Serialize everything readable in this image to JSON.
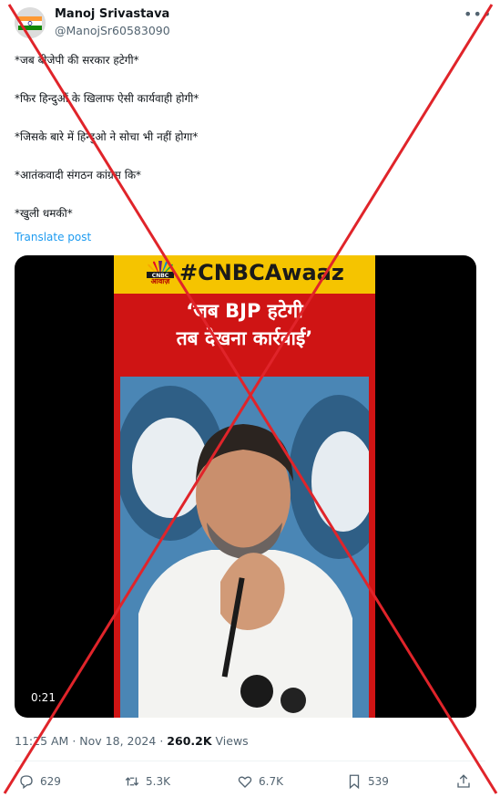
{
  "author": {
    "name": "Manoj Srivastava",
    "handle": "@ManojSr60583090"
  },
  "tweet_lines": [
    "*जब बीजेपी की सरकार हटेगी*",
    "*फिर हिन्दुओं के खिलाफ ऐसी कार्यवाही होगी*",
    "*जिसके बारे में हिन्दुओ ने सोचा भी नहीं होगा*",
    "*आतंकवादी संगठन कांग्रेस कि*",
    "*खुली धमकी*"
  ],
  "translate_label": "Translate post",
  "media": {
    "logo_text": "आवाज़",
    "hashtag": "#CNBCAwaaz",
    "quote_line1": "‘जब BJP हटेगी",
    "quote_line2": "तब देखना कार्रवाई’",
    "duration": "0:21"
  },
  "meta": {
    "time": "11:25 AM",
    "separator": "·",
    "date": "Nov 18, 2024",
    "views_count": "260.2K",
    "views_label": "Views"
  },
  "actions": {
    "replies": "629",
    "reposts": "5.3K",
    "likes": "6.7K",
    "bookmarks": "539"
  },
  "icons": {
    "more": "more-horizontal-icon",
    "reply": "reply-icon",
    "repost": "repost-icon",
    "like": "heart-icon",
    "bookmark": "bookmark-icon",
    "share": "share-icon"
  },
  "colors": {
    "link": "#1d9bf0",
    "secondary_text": "#536471",
    "cross_overlay": "#e0242a",
    "banner_yellow": "#f5c400",
    "banner_red": "#cf1414"
  }
}
